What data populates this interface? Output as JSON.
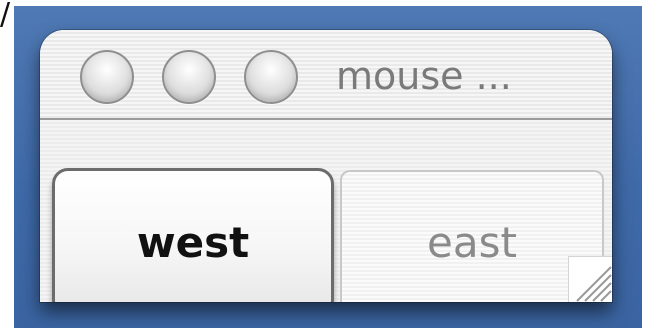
{
  "leading_glyph": "/",
  "window": {
    "title": "mouse ...",
    "traffic_lights": [
      "close",
      "minimize",
      "zoom"
    ]
  },
  "buttons": {
    "west": "west",
    "east": "east"
  },
  "icons": {
    "resize": "resize-grip-icon"
  },
  "colors": {
    "desktop": "#4674b0",
    "window_bg": "#eeeeee",
    "title_text": "#7a7a7a",
    "west_text": "#111111",
    "east_text": "#8a8a8a"
  }
}
